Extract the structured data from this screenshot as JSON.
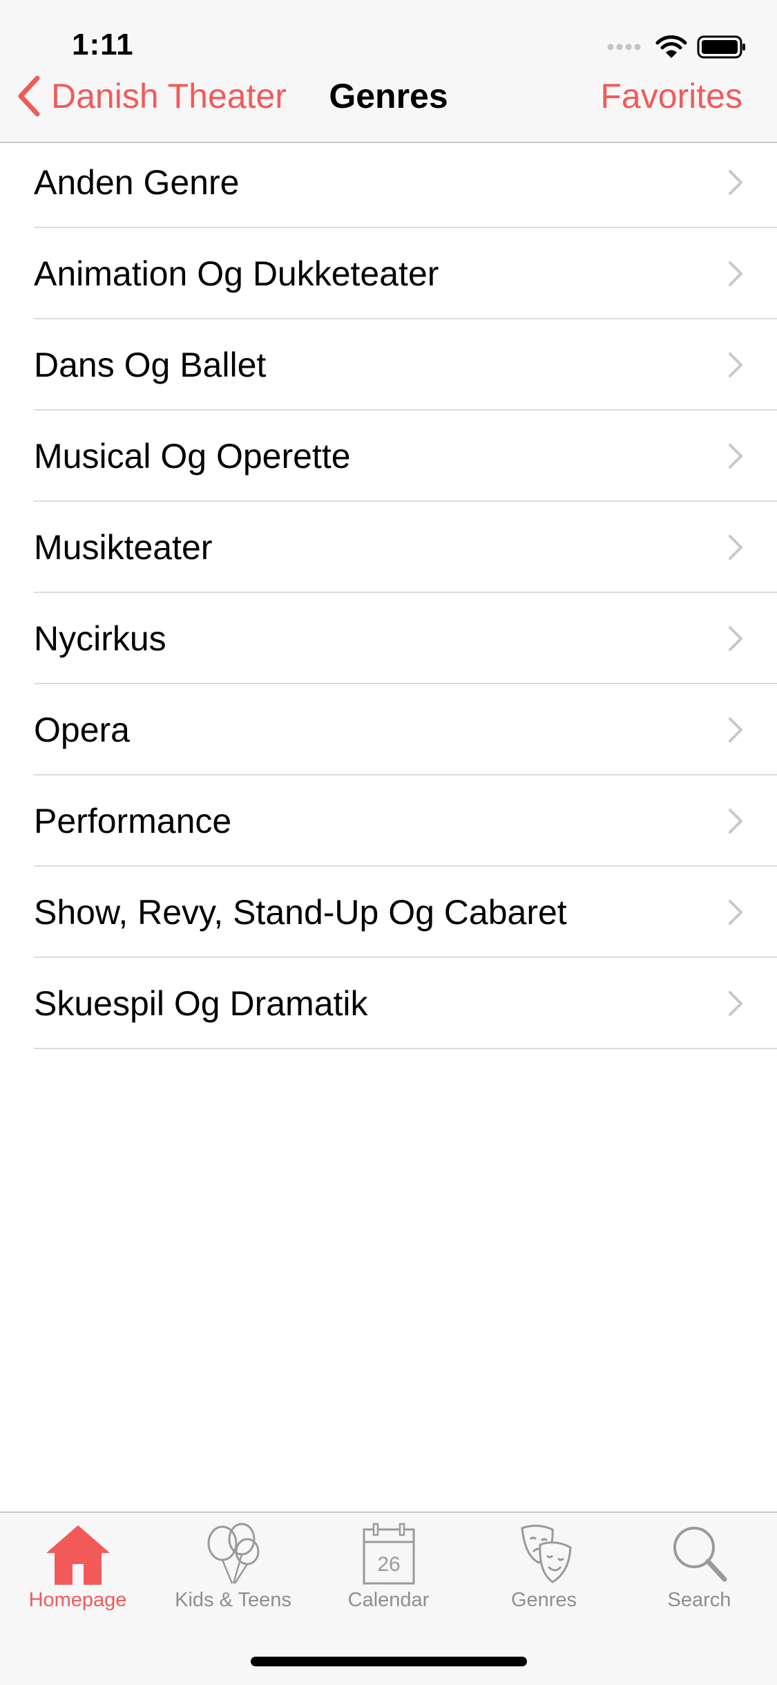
{
  "status_bar": {
    "time": "1:11"
  },
  "nav": {
    "back_label": "Danish Theater",
    "title": "Genres",
    "right_label": "Favorites"
  },
  "genres": [
    "Anden Genre",
    "Animation Og Dukketeater",
    "Dans Og Ballet",
    "Musical Og Operette",
    "Musikteater",
    "Nycirkus",
    "Opera",
    "Performance",
    "Show, Revy, Stand-Up Og Cabaret",
    "Skuespil Og Dramatik"
  ],
  "tabs": [
    {
      "label": "Homepage",
      "icon": "house-icon",
      "active": true
    },
    {
      "label": "Kids & Teens",
      "icon": "balloons-icon",
      "active": false
    },
    {
      "label": "Calendar",
      "icon": "calendar-icon",
      "active": false,
      "date": "26"
    },
    {
      "label": "Genres",
      "icon": "theater-masks-icon",
      "active": false
    },
    {
      "label": "Search",
      "icon": "magnifier-icon",
      "active": false
    }
  ],
  "colors": {
    "accent": "#f25a5a",
    "inactive": "#8e8e93",
    "bar_background": "#f7f7f7"
  }
}
